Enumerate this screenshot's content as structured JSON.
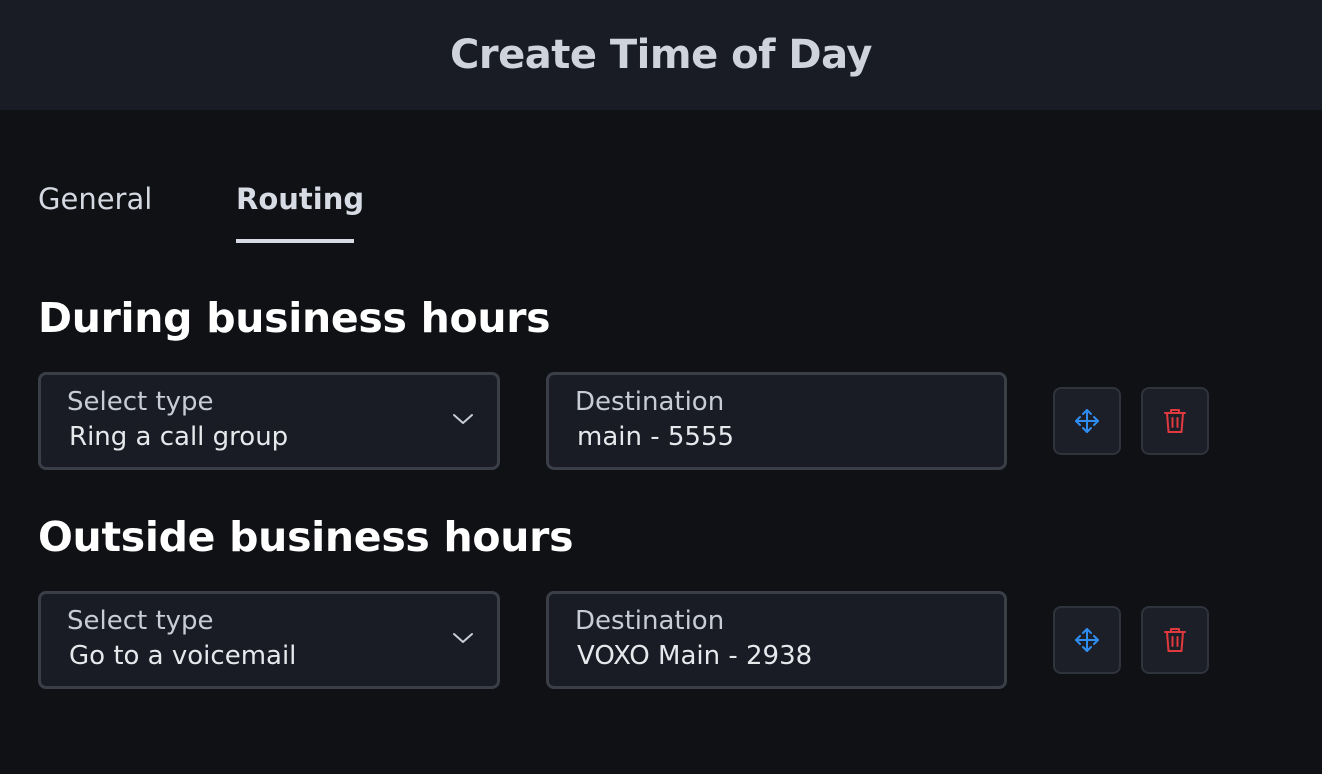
{
  "header": {
    "title": "Create Time of Day"
  },
  "tabs": [
    {
      "label": "General",
      "active": false
    },
    {
      "label": "Routing",
      "active": true
    }
  ],
  "sections": [
    {
      "title": "During business hours",
      "select_type": {
        "label": "Select type",
        "value": "Ring a call group"
      },
      "destination": {
        "label": "Destination",
        "value": "main - 5555"
      }
    },
    {
      "title": "Outside business hours",
      "select_type": {
        "label": "Select type",
        "value": "Go to a voicemail"
      },
      "destination": {
        "label": "Destination",
        "value": "VOXO Main - 2938"
      }
    }
  ],
  "icons": {
    "move": "move-arrows-icon",
    "delete": "trash-icon",
    "dropdown": "chevron-down-icon"
  },
  "colors": {
    "move_icon": "#2f8cf0",
    "delete_icon": "#e0393e",
    "background": "#0f1115",
    "header_background": "#191c24"
  }
}
